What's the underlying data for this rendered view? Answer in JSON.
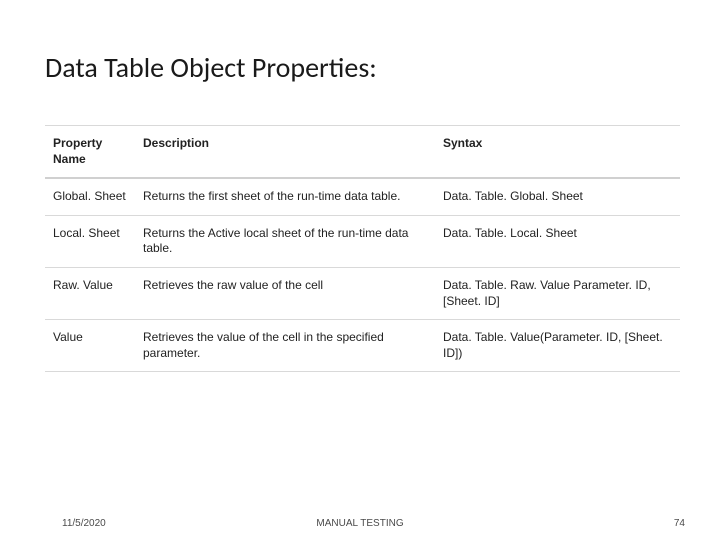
{
  "title": "Data Table Object Properties:",
  "table": {
    "headers": {
      "name": "Property Name",
      "desc": "Description",
      "syntax": "Syntax"
    },
    "rows": [
      {
        "name": "Global. Sheet",
        "desc": "Returns the first sheet of the run-time data table.",
        "syntax": "Data. Table. Global. Sheet"
      },
      {
        "name": "Local. Sheet",
        "desc": "Returns the Active local sheet of the run-time data table.",
        "syntax": "Data. Table. Local. Sheet"
      },
      {
        "name": "Raw. Value",
        "desc": "Retrieves the raw value of the cell",
        "syntax": "Data. Table. Raw. Value Parameter. ID, [Sheet. ID]"
      },
      {
        "name": "Value",
        "desc": "Retrieves the value of the cell in the specified parameter.",
        "syntax": "Data. Table. Value(Parameter. ID, [Sheet. ID])"
      }
    ]
  },
  "footer": {
    "date": "11/5/2020",
    "label": "MANUAL TESTING",
    "page": "74"
  }
}
